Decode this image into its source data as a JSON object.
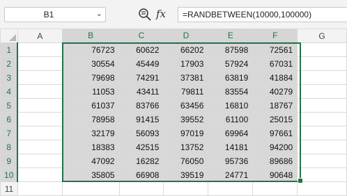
{
  "formula_bar": {
    "name_box": "B1",
    "name_box_chevron_icon": "chevron-down-icon",
    "zoom_icon": "zoom-formula-icon",
    "fx_label": "fx",
    "formula": "=RANDBETWEEN(10000,100000)"
  },
  "columns": [
    "A",
    "B",
    "C",
    "D",
    "E",
    "F",
    "G"
  ],
  "rows": [
    {
      "num": "1",
      "cells": [
        "",
        "76723",
        "60622",
        "66202",
        "87598",
        "72561",
        ""
      ]
    },
    {
      "num": "2",
      "cells": [
        "",
        "30554",
        "45449",
        "17903",
        "57924",
        "67031",
        ""
      ]
    },
    {
      "num": "3",
      "cells": [
        "",
        "79698",
        "74291",
        "37381",
        "63819",
        "41884",
        ""
      ]
    },
    {
      "num": "4",
      "cells": [
        "",
        "11053",
        "43411",
        "79811",
        "83554",
        "40279",
        ""
      ]
    },
    {
      "num": "5",
      "cells": [
        "",
        "61037",
        "83766",
        "63456",
        "16810",
        "18767",
        ""
      ]
    },
    {
      "num": "6",
      "cells": [
        "",
        "78958",
        "91415",
        "39552",
        "61100",
        "25015",
        ""
      ]
    },
    {
      "num": "7",
      "cells": [
        "",
        "32179",
        "56093",
        "97019",
        "69964",
        "97661",
        ""
      ]
    },
    {
      "num": "8",
      "cells": [
        "",
        "18383",
        "42515",
        "13752",
        "14181",
        "94200",
        ""
      ]
    },
    {
      "num": "9",
      "cells": [
        "",
        "47092",
        "16282",
        "76050",
        "95736",
        "89686",
        ""
      ]
    },
    {
      "num": "10",
      "cells": [
        "",
        "35805",
        "66908",
        "39519",
        "24771",
        "90648",
        ""
      ]
    },
    {
      "num": "11",
      "cells": [
        "",
        "",
        "",
        "",
        "",
        "",
        ""
      ]
    }
  ],
  "selection": {
    "range": "B1:F10",
    "accent": "#217346"
  }
}
